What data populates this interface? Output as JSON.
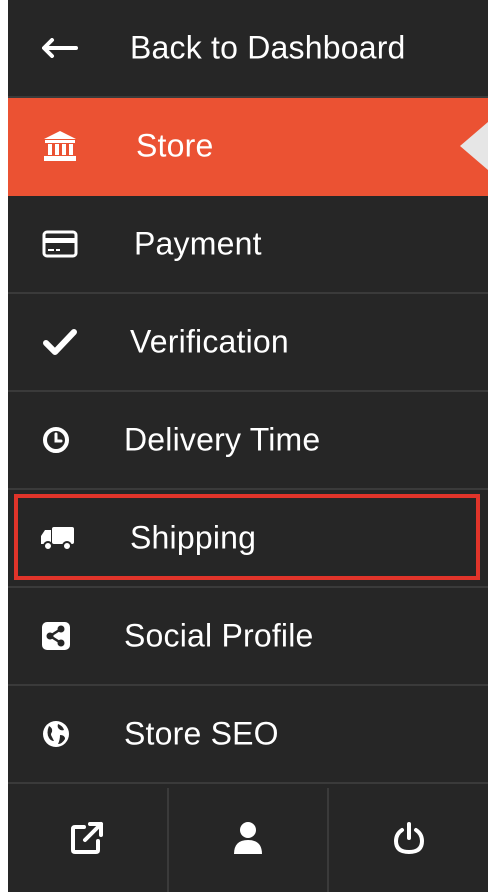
{
  "menu": {
    "items": [
      {
        "label": "Back to Dashboard",
        "icon": "arrow-left-icon"
      },
      {
        "label": "Store",
        "icon": "bank-icon",
        "active": true
      },
      {
        "label": "Payment",
        "icon": "credit-card-icon"
      },
      {
        "label": "Verification",
        "icon": "check-icon"
      },
      {
        "label": "Delivery Time",
        "icon": "clock-icon"
      },
      {
        "label": "Shipping",
        "icon": "truck-icon",
        "highlighted": true
      },
      {
        "label": "Social Profile",
        "icon": "share-icon"
      },
      {
        "label": "Store SEO",
        "icon": "globe-icon"
      }
    ]
  },
  "footer": {
    "buttons": [
      {
        "icon": "external-link-icon"
      },
      {
        "icon": "user-icon"
      },
      {
        "icon": "power-icon"
      }
    ]
  },
  "colors": {
    "sidebar_bg": "#262626",
    "active_bg": "#eb5233",
    "highlight_border": "#e0342a",
    "text": "#ffffff"
  }
}
